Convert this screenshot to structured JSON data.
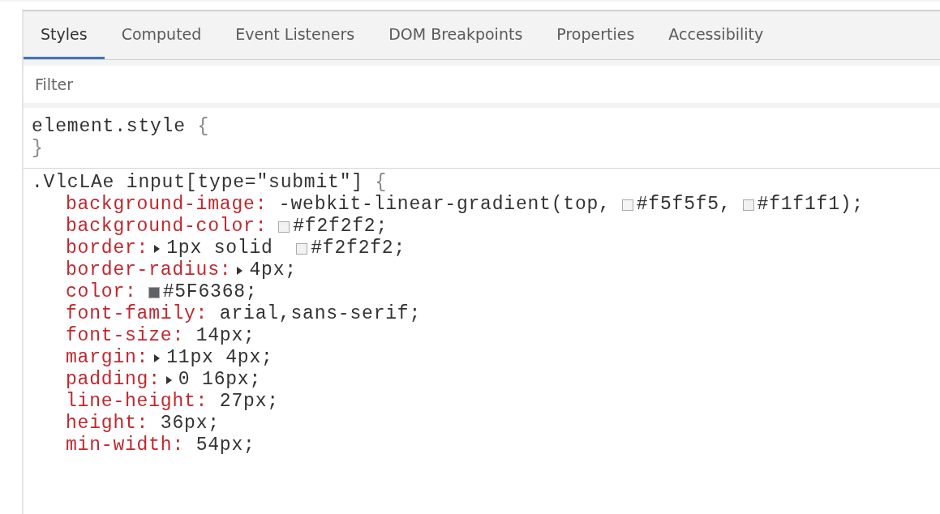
{
  "tabs": [
    {
      "label": "Styles",
      "selected": true
    },
    {
      "label": "Computed",
      "selected": false
    },
    {
      "label": "Event Listeners",
      "selected": false
    },
    {
      "label": "DOM Breakpoints",
      "selected": false
    },
    {
      "label": "Properties",
      "selected": false
    },
    {
      "label": "Accessibility",
      "selected": false
    }
  ],
  "filter": {
    "placeholder": "Filter"
  },
  "rules": [
    {
      "selector": "element.style",
      "open": "{",
      "close": "}"
    },
    {
      "selector": ".VlcLAe input[type=\"submit\"]",
      "open": "{",
      "declarations": [
        {
          "name": "background-image",
          "sep": ":",
          "parts": [
            {
              "kind": "text",
              "text": " -webkit-linear-gradient(top,"
            },
            {
              "kind": "swatch",
              "color": "#f5f5f5"
            },
            {
              "kind": "text",
              "text": "#f5f5f5,"
            },
            {
              "kind": "swatch",
              "color": "#f1f1f1"
            },
            {
              "kind": "text",
              "text": "#f1f1f1);"
            }
          ]
        },
        {
          "name": "background-color",
          "sep": ":",
          "parts": [
            {
              "kind": "swatch",
              "color": "#f2f2f2"
            },
            {
              "kind": "text",
              "text": "#f2f2f2;"
            }
          ]
        },
        {
          "name": "border",
          "sep": ":",
          "parts": [
            {
              "kind": "expander"
            },
            {
              "kind": "text",
              "text": "1px solid "
            },
            {
              "kind": "swatch",
              "color": "#f2f2f2"
            },
            {
              "kind": "text",
              "text": "#f2f2f2;"
            }
          ]
        },
        {
          "name": "border-radius",
          "sep": ":",
          "parts": [
            {
              "kind": "expander"
            },
            {
              "kind": "text",
              "text": "4px;"
            }
          ]
        },
        {
          "name": "color",
          "sep": ":",
          "parts": [
            {
              "kind": "swatch",
              "color": "#5f6368"
            },
            {
              "kind": "text",
              "text": "#5F6368;"
            }
          ]
        },
        {
          "name": "font-family",
          "sep": ":",
          "parts": [
            {
              "kind": "text",
              "text": " arial,sans-serif;"
            }
          ]
        },
        {
          "name": "font-size",
          "sep": ":",
          "parts": [
            {
              "kind": "text",
              "text": " 14px;"
            }
          ]
        },
        {
          "name": "margin",
          "sep": ":",
          "parts": [
            {
              "kind": "expander"
            },
            {
              "kind": "text",
              "text": "11px 4px;"
            }
          ]
        },
        {
          "name": "padding",
          "sep": ":",
          "parts": [
            {
              "kind": "expander"
            },
            {
              "kind": "text",
              "text": "0 16px;"
            }
          ]
        },
        {
          "name": "line-height",
          "sep": ":",
          "parts": [
            {
              "kind": "text",
              "text": " 27px;"
            }
          ]
        },
        {
          "name": "height",
          "sep": ":",
          "parts": [
            {
              "kind": "text",
              "text": " 36px;"
            }
          ]
        },
        {
          "name": "min-width",
          "sep": ":",
          "parts": [
            {
              "kind": "text",
              "text": " 54px;"
            }
          ]
        }
      ]
    }
  ]
}
